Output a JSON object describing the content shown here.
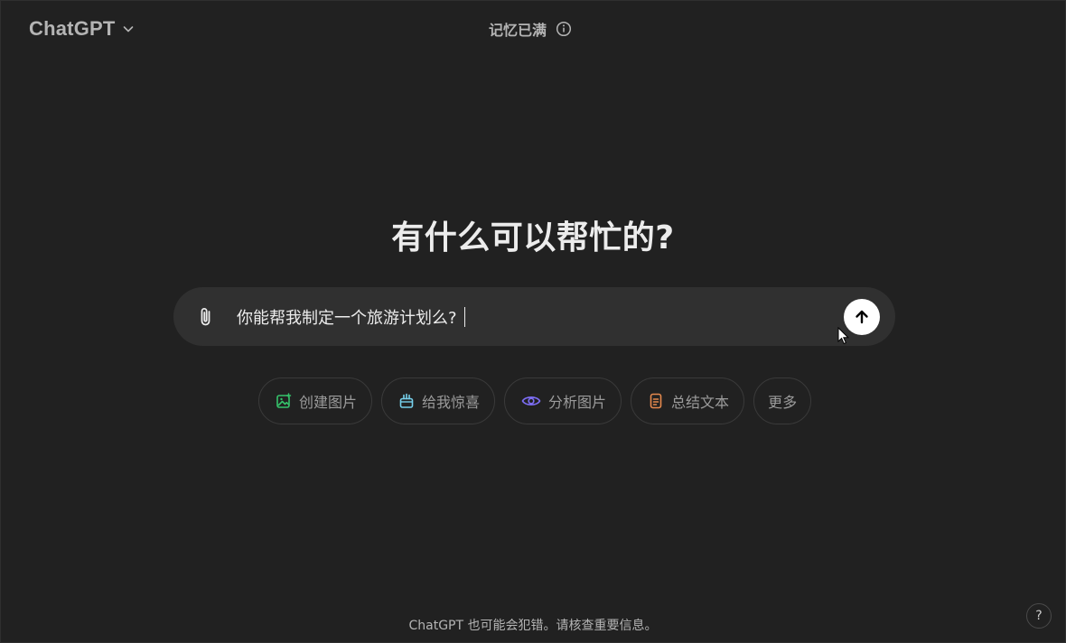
{
  "header": {
    "model_name": "ChatGPT",
    "memory_status": "记忆已满"
  },
  "main": {
    "title": "有什么可以帮忙的?"
  },
  "composer": {
    "input_value": "你能帮我制定一个旅游计划么?"
  },
  "suggestions": [
    {
      "label": "创建图片",
      "icon": "image-create-icon",
      "color": "#35c26a"
    },
    {
      "label": "给我惊喜",
      "icon": "gift-icon",
      "color": "#76d0eb"
    },
    {
      "label": "分析图片",
      "icon": "eye-icon",
      "color": "#7c6df2"
    },
    {
      "label": "总结文本",
      "icon": "document-icon",
      "color": "#e68a4e"
    },
    {
      "label": "更多",
      "icon": "",
      "color": ""
    }
  ],
  "footer": {
    "disclaimer": "ChatGPT 也可能会犯错。请核查重要信息。",
    "help_label": "?"
  },
  "colors": {
    "background": "#212121",
    "composer": "#303030",
    "send_button": "#ffffff"
  }
}
